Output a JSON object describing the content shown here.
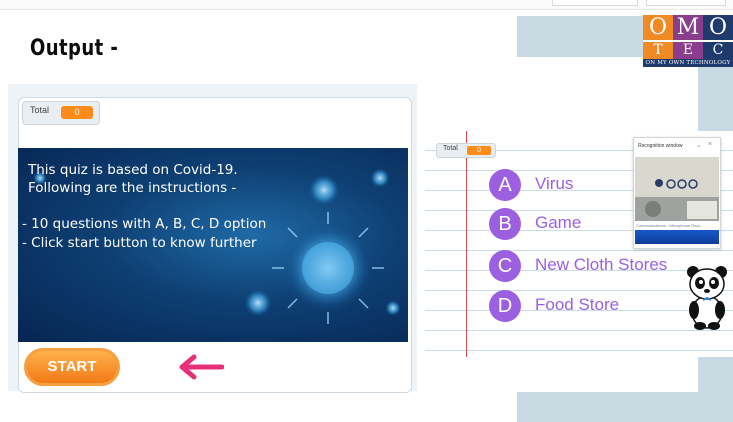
{
  "heading": "Output -",
  "logo": {
    "letters_top": [
      "O",
      "M",
      "O"
    ],
    "letters_bottom": [
      "T",
      "E",
      "C"
    ],
    "tagline": "On My Own Technology",
    "colors": {
      "orange": "#f08a24",
      "purple": "#8a3d8c",
      "navy": "#1f3b6e"
    }
  },
  "left_stage": {
    "monitor_label": "Total",
    "monitor_value": "0",
    "banner_lines": [
      "This quiz is based on Covid-19.",
      "Following are the instructions -",
      "- 10 questions with A, B, C, D option",
      "- Click start button to know further"
    ],
    "start_label": "START",
    "arrow_icon": "left-arrow-icon",
    "accent": "#ff8c1a"
  },
  "right_stage": {
    "monitor_label": "Total",
    "monitor_value": "0",
    "options": [
      {
        "letter": "A",
        "text": "Virus"
      },
      {
        "letter": "B",
        "text": "Game"
      },
      {
        "letter": "C",
        "text": "New Cloth Stores"
      },
      {
        "letter": "D",
        "text": "Food Store"
      }
    ],
    "option_color": "#9b5fe0",
    "mascot_icon": "panda-icon",
    "recognition_window": {
      "title": "Recognition window",
      "status": "Communications - Microphone Real..."
    }
  }
}
